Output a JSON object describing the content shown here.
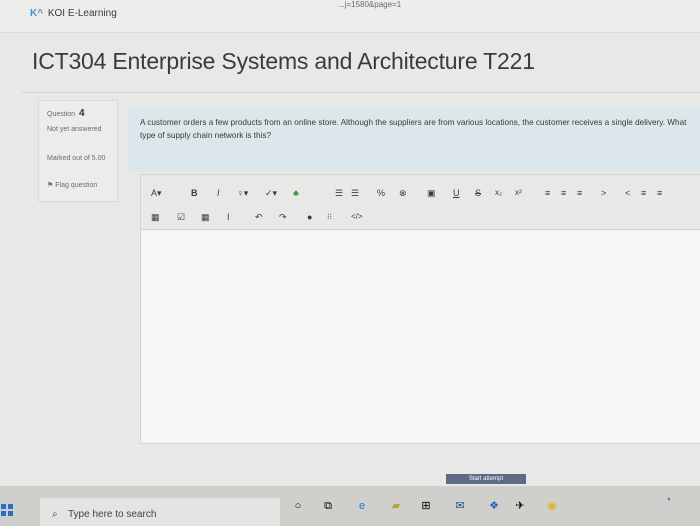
{
  "browser": {
    "url_fragment": "...j=1580&page=1"
  },
  "site": {
    "brand": "KOI E-Learning"
  },
  "page": {
    "title": "ICT304 Enterprise Systems and Architecture T221"
  },
  "question": {
    "label": "Question",
    "number": "4",
    "status": "Not yet answered",
    "marks": "Marked out of 5.00",
    "flag_label": "Flag question",
    "text": "A customer orders a few products from an online store. Although the suppliers are from various locations, the customer receives a single delivery. What type of supply chain network is this?"
  },
  "editor": {
    "toolbar_row1": [
      "A▾",
      "B",
      "I",
      "♀▾",
      "✓▾",
      "♣",
      "☰",
      "☰",
      "%",
      "⊗",
      "▣",
      "U",
      "S",
      "x₂",
      "x²",
      "≡",
      "≡",
      "≡",
      ">",
      "<",
      "≡",
      "≡"
    ],
    "toolbar_row2": [
      "▦",
      "☑",
      "▦",
      "I",
      "↶",
      "↷",
      "●",
      "⁝⁝",
      "</>"
    ]
  },
  "footer": {
    "start_attempt": "Start attempt"
  },
  "taskbar": {
    "search_placeholder": "Type here to search"
  }
}
